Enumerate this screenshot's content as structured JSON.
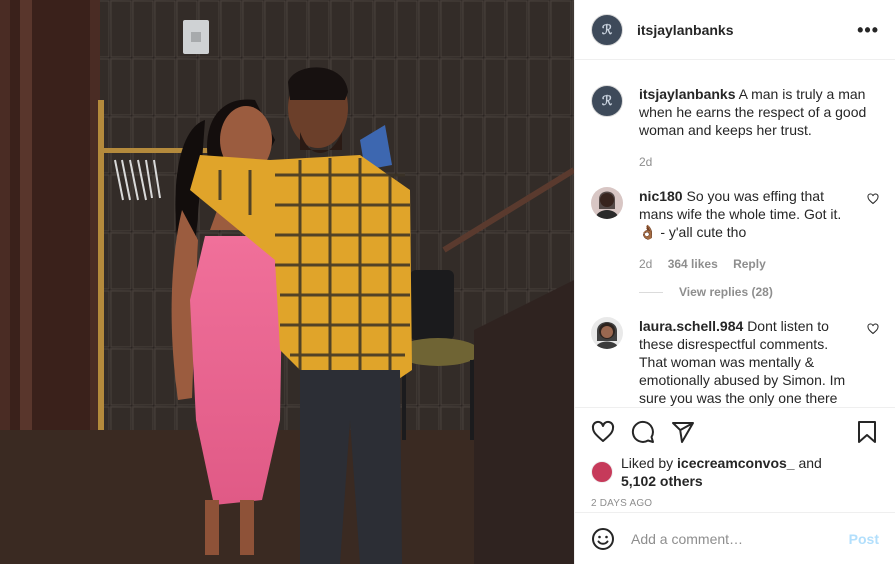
{
  "post": {
    "username": "itsjaylanbanks",
    "more_icon": "more-icon",
    "caption_user": "itsjaylanbanks",
    "caption_text": "A man is truly a man when he earns the respect of a good woman and keeps her trust.",
    "caption_time": "2d"
  },
  "comments": [
    {
      "user": "nic180",
      "text": "So you was effing that mans wife the whole time. Got it. 👌🏾 - y'all cute tho",
      "time": "2d",
      "likes": "364 likes",
      "reply": "Reply",
      "view_replies": "View replies (28)"
    },
    {
      "user": "laura.schell.984",
      "text": "Dont listen to these disrespectful comments. That woman was mentally & emotionally abused by Simon. Im sure you was the only one there"
    }
  ],
  "liked": {
    "prefix": "Liked by",
    "user": "icecreamconvos_",
    "and": "and",
    "others": "5,102 others"
  },
  "time_ago": "2 DAYS AGO",
  "add_comment": {
    "placeholder": "Add a comment…",
    "post_label": "Post"
  },
  "colors": {
    "accent": "#0095f6",
    "post_disabled": "#b2dffc",
    "muted": "#8e8e8e"
  }
}
